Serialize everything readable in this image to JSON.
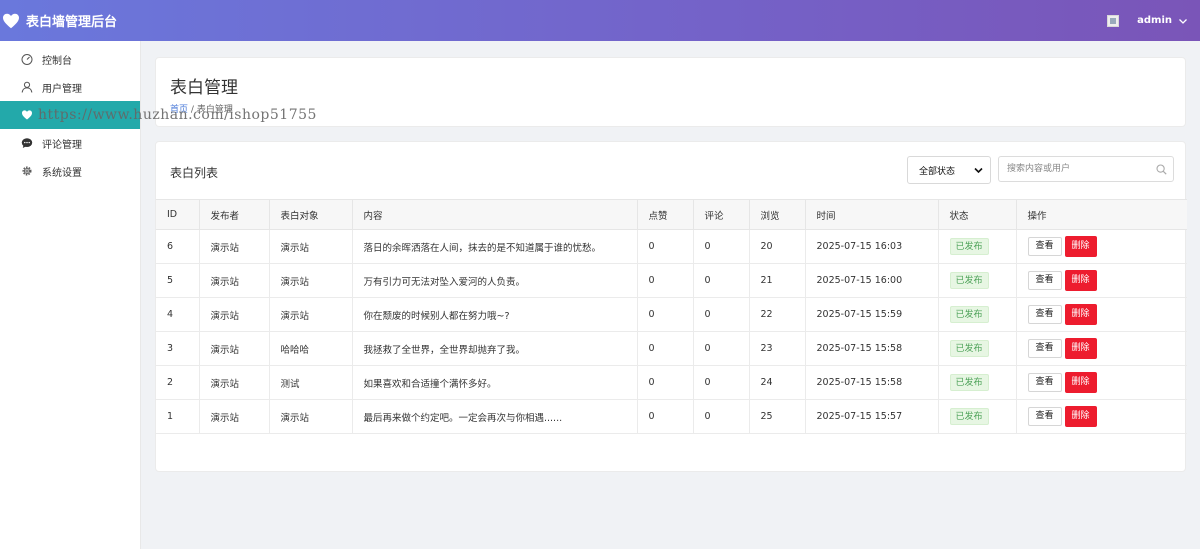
{
  "app": {
    "title": "表白墙管理后台"
  },
  "user": {
    "name": "admin"
  },
  "sidebar": {
    "items": [
      {
        "label": "控制台",
        "icon": "dashboard-icon"
      },
      {
        "label": "用户管理",
        "icon": "user-icon"
      },
      {
        "label": "",
        "icon": "heart-icon",
        "active": true
      },
      {
        "label": "评论管理",
        "icon": "comment-icon"
      },
      {
        "label": "系统设置",
        "icon": "gear-icon"
      }
    ]
  },
  "watermark": "https://www.huzhan.com/ishop51755",
  "page": {
    "title": "表白管理",
    "breadcrumb": {
      "home": "首页",
      "separator": "/",
      "current": "表白管理"
    }
  },
  "list": {
    "title": "表白列表",
    "filter": {
      "selected": "全部状态"
    },
    "search": {
      "placeholder": "搜索内容或用户"
    },
    "columns": [
      "ID",
      "发布者",
      "表白对象",
      "内容",
      "点赞",
      "评论",
      "浏览",
      "时间",
      "状态",
      "操作"
    ],
    "rows": [
      {
        "id": "6",
        "publisher": "演示站",
        "target": "演示站",
        "content": "落日的余晖洒落在人间，抹去的是不知道属于谁的忧愁。",
        "likes": "0",
        "comments": "0",
        "views": "20",
        "time": "2025-07-15 16:03",
        "status": "已发布"
      },
      {
        "id": "5",
        "publisher": "演示站",
        "target": "演示站",
        "content": "万有引力可无法对坠入爱河的人负责。",
        "likes": "0",
        "comments": "0",
        "views": "21",
        "time": "2025-07-15 16:00",
        "status": "已发布"
      },
      {
        "id": "4",
        "publisher": "演示站",
        "target": "演示站",
        "content": "你在颓废的时候别人都在努力哦~?",
        "likes": "0",
        "comments": "0",
        "views": "22",
        "time": "2025-07-15 15:59",
        "status": "已发布"
      },
      {
        "id": "3",
        "publisher": "演示站",
        "target": "哈哈哈",
        "content": "我拯救了全世界，全世界却抛弃了我。",
        "likes": "0",
        "comments": "0",
        "views": "23",
        "time": "2025-07-15 15:58",
        "status": "已发布"
      },
      {
        "id": "2",
        "publisher": "演示站",
        "target": "测试",
        "content": "如果喜欢和合适撞个满怀多好。",
        "likes": "0",
        "comments": "0",
        "views": "24",
        "time": "2025-07-15 15:58",
        "status": "已发布"
      },
      {
        "id": "1",
        "publisher": "演示站",
        "target": "演示站",
        "content": "最后再来做个约定吧。一定会再次与你相遇......",
        "likes": "0",
        "comments": "0",
        "views": "25",
        "time": "2025-07-15 15:57",
        "status": "已发布"
      }
    ],
    "actions": {
      "view": "查看",
      "delete": "删除"
    }
  },
  "colors": {
    "accent": "#23a9aa",
    "header_start": "#6a78dc",
    "header_end": "#7a55b8",
    "danger": "#ed1c2e",
    "status_text": "#4fa35a"
  }
}
